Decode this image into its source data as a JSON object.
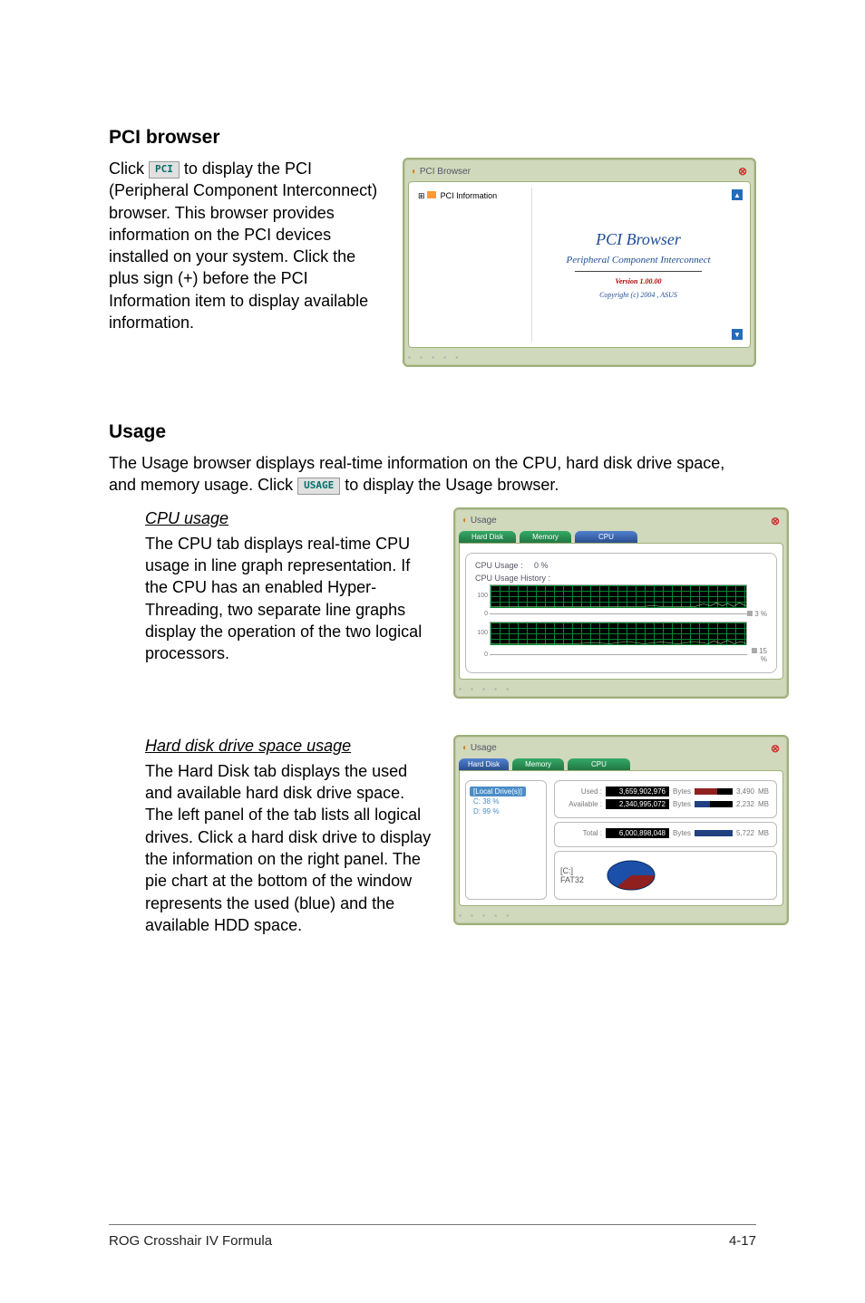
{
  "sections": {
    "pci": {
      "heading": "PCI browser",
      "para_pre": "Click ",
      "btn": "PCI",
      "para_post": " to display the PCI (Peripheral Component Interconnect) browser. This browser provides information on the PCI devices installed on your system. Click the plus sign (+) before the PCI Information item to display available information."
    },
    "usage": {
      "heading": "Usage",
      "para_pre": "The Usage browser displays real-time information on the CPU, hard disk drive space, and memory usage. Click ",
      "btn": "USAGE",
      "para_post": " to display the Usage browser.",
      "cpu": {
        "heading": "CPU usage",
        "body": "The CPU tab displays real-time CPU usage in line graph representation. If the CPU has an enabled Hyper-Threading, two separate line graphs display the operation of the two logical processors."
      },
      "hdd": {
        "heading": "Hard disk drive space usage",
        "body": "The Hard Disk tab displays the used and available hard disk drive space. The left panel of the tab lists all logical drives. Click a hard disk drive to display the information on the right panel. The pie chart at the bottom of the window represents the used (blue) and the available HDD space."
      }
    }
  },
  "pci_window": {
    "title": "PCI Browser",
    "tree_root": "PCI Information",
    "main_title": "PCI  Browser",
    "subtitle": "Peripheral Component Interconnect",
    "version": "Version 1.00.00",
    "copyright": "Copyright (c) 2004 ,  ASUS"
  },
  "usage_cpu_window": {
    "title": "Usage",
    "tabs": [
      "Hard Disk",
      "Memory",
      "CPU"
    ],
    "cpu_usage_label": "CPU Usage :",
    "cpu_usage_value": "0  %",
    "history_label": "CPU Usage History :",
    "axis_100": "100",
    "axis_0": "0",
    "pct_a": "3 %",
    "pct_b": "15 %"
  },
  "usage_hdd_window": {
    "title": "Usage",
    "tabs": [
      "Hard Disk",
      "Memory",
      "CPU"
    ],
    "left_header": "[Local Drive(s)]",
    "drives": [
      "C: 38 %",
      "D: 99 %"
    ],
    "stats": {
      "used_label": "Used :",
      "used_bytes": "3,659,902,976",
      "used_unit": "Bytes",
      "used_mb": "3,490",
      "used_mb_unit": "MB",
      "used_fill_pct": 60,
      "avail_label": "Available :",
      "avail_bytes": "2,340,995,072",
      "avail_unit": "Bytes",
      "avail_mb": "2,232",
      "avail_mb_unit": "MB",
      "avail_fill_pct": 40,
      "total_label": "Total :",
      "total_bytes": "6,000,898,048",
      "total_unit": "Bytes",
      "total_mb": "5,722",
      "total_mb_unit": "MB",
      "total_fill_pct": 100
    },
    "pie_label_drive": "[C:]",
    "pie_label_fs": "FAT32"
  },
  "footer": {
    "left": "ROG Crosshair IV Formula",
    "right": "4-17"
  }
}
